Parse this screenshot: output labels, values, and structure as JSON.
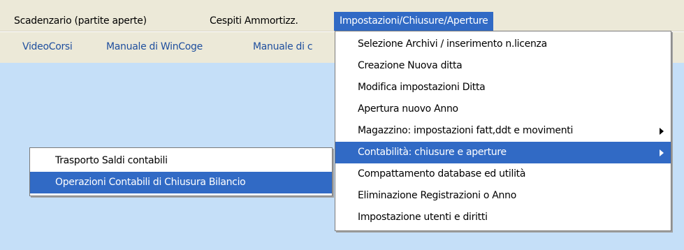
{
  "menubar": {
    "items": [
      {
        "label": "Scadenzario (partite aperte)"
      },
      {
        "label": "Cespiti Ammortizz."
      },
      {
        "label": "Impostazioni/Chiusure/Aperture"
      }
    ]
  },
  "toolbar": {
    "links": [
      {
        "label": "VideoCorsi"
      },
      {
        "label": "Manuale di WinCoge"
      },
      {
        "label": "Manuale di c"
      }
    ]
  },
  "main_menu": {
    "items": [
      {
        "label": "Selezione Archivi / inserimento n.licenza",
        "has_submenu": false
      },
      {
        "label": "Creazione Nuova ditta",
        "has_submenu": false
      },
      {
        "label": "Modifica impostazioni Ditta",
        "has_submenu": false
      },
      {
        "label": "Apertura nuovo Anno",
        "has_submenu": false
      },
      {
        "label": "Magazzino: impostazioni fatt,ddt e movimenti",
        "has_submenu": true
      },
      {
        "label": "Contabilità: chiusure e aperture",
        "has_submenu": true
      },
      {
        "label": "Compattamento database ed utilità",
        "has_submenu": false
      },
      {
        "label": "Eliminazione Registrazioni o Anno",
        "has_submenu": false
      },
      {
        "label": "Impostazione utenti e diritti",
        "has_submenu": false
      }
    ]
  },
  "sub_menu": {
    "items": [
      {
        "label": "Trasporto Saldi contabili"
      },
      {
        "label": "Operazioni Contabili di Chiusura Bilancio"
      }
    ]
  },
  "colors": {
    "highlight": "#316ac5",
    "menubar_bg": "#ece9d8",
    "content_bg": "#c5dff8",
    "link": "#1f4f9e"
  }
}
